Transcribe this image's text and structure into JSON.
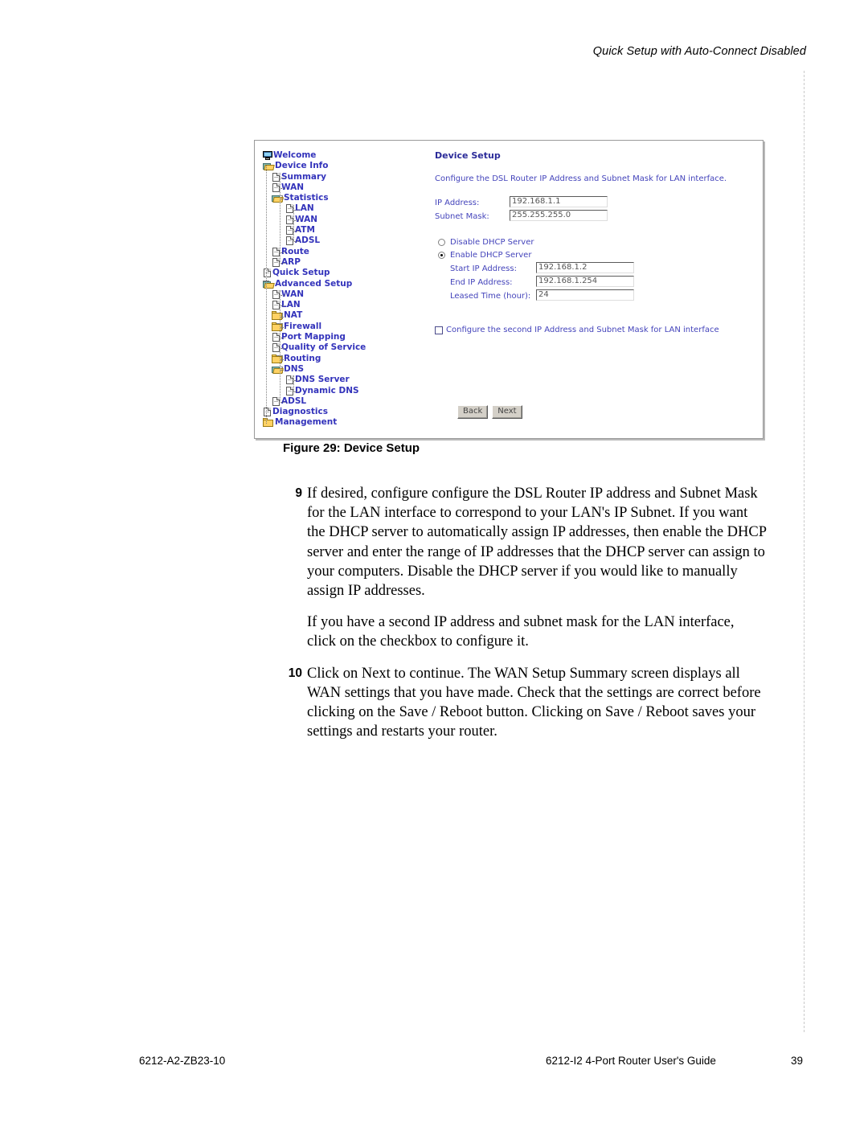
{
  "page": {
    "running_header": "Quick Setup with Auto-Connect Disabled",
    "footer_left": "6212-A2-ZB23-10",
    "footer_guide": "6212-I2 4-Port Router User's Guide",
    "footer_page_number": "39"
  },
  "figure": {
    "caption": "Figure 29: Device Setup"
  },
  "screenshot": {
    "tree": [
      {
        "label": "Welcome",
        "level": 0,
        "icon": "monitor-icon",
        "expander": "none"
      },
      {
        "label": "Device Info",
        "level": 0,
        "icon": "folder-open-icon",
        "expander": "minus"
      },
      {
        "label": "Summary",
        "level": 1,
        "icon": "page-icon",
        "expander": "none"
      },
      {
        "label": "WAN",
        "level": 1,
        "icon": "page-icon",
        "expander": "none"
      },
      {
        "label": "Statistics",
        "level": 1,
        "icon": "folder-open-icon",
        "expander": "minus"
      },
      {
        "label": "LAN",
        "level": 2,
        "icon": "page-icon",
        "expander": "none"
      },
      {
        "label": "WAN",
        "level": 2,
        "icon": "page-icon",
        "expander": "none"
      },
      {
        "label": "ATM",
        "level": 2,
        "icon": "page-icon",
        "expander": "none"
      },
      {
        "label": "ADSL",
        "level": 2,
        "icon": "page-icon",
        "expander": "none"
      },
      {
        "label": "Route",
        "level": 1,
        "icon": "page-icon",
        "expander": "none"
      },
      {
        "label": "ARP",
        "level": 1,
        "icon": "page-icon",
        "expander": "none"
      },
      {
        "label": "Quick Setup",
        "level": 0,
        "icon": "page-icon",
        "expander": "none"
      },
      {
        "label": "Advanced Setup",
        "level": 0,
        "icon": "folder-open-icon",
        "expander": "minus"
      },
      {
        "label": "WAN",
        "level": 1,
        "icon": "page-icon",
        "expander": "none"
      },
      {
        "label": "LAN",
        "level": 1,
        "icon": "page-icon",
        "expander": "none"
      },
      {
        "label": "NAT",
        "level": 1,
        "icon": "folder-icon",
        "expander": "plus"
      },
      {
        "label": "Firewall",
        "level": 1,
        "icon": "folder-icon",
        "expander": "plus"
      },
      {
        "label": "Port Mapping",
        "level": 1,
        "icon": "page-icon",
        "expander": "none"
      },
      {
        "label": "Quality of Service",
        "level": 1,
        "icon": "page-icon",
        "expander": "none"
      },
      {
        "label": "Routing",
        "level": 1,
        "icon": "folder-icon",
        "expander": "plus"
      },
      {
        "label": "DNS",
        "level": 1,
        "icon": "folder-open-icon",
        "expander": "minus"
      },
      {
        "label": "DNS Server",
        "level": 2,
        "icon": "page-icon",
        "expander": "none"
      },
      {
        "label": "Dynamic DNS",
        "level": 2,
        "icon": "page-icon",
        "expander": "none"
      },
      {
        "label": "ADSL",
        "level": 1,
        "icon": "page-icon",
        "expander": "none"
      },
      {
        "label": "Diagnostics",
        "level": 0,
        "icon": "page-icon",
        "expander": "none"
      },
      {
        "label": "Management",
        "level": 0,
        "icon": "folder-icon",
        "expander": "plus"
      }
    ],
    "panel": {
      "title": "Device Setup",
      "description": "Configure the DSL Router IP Address and Subnet Mask for LAN interface.",
      "ip_address_label": "IP Address:",
      "ip_address_value": "192.168.1.1",
      "subnet_mask_label": "Subnet Mask:",
      "subnet_mask_value": "255.255.255.0",
      "disable_dhcp_label": "Disable DHCP Server",
      "enable_dhcp_label": "Enable DHCP Server",
      "dhcp_selected": "Enable DHCP Server",
      "start_ip_label": "Start IP Address:",
      "start_ip_value": "192.168.1.2",
      "end_ip_label": "End IP Address:",
      "end_ip_value": "192.168.1.254",
      "leased_time_label": "Leased Time (hour):",
      "leased_time_value": "24",
      "second_ip_checkbox_label": "Configure the second IP Address and Subnet Mask for LAN interface",
      "second_ip_checked": false,
      "back_button": "Back",
      "next_button": "Next"
    }
  },
  "body": {
    "steps": [
      {
        "number": "9",
        "text": "If desired, configure configure the DSL Router IP address and Subnet Mask for the LAN interface to correspond to your LAN's IP Subnet. If you want the DHCP server to automatically assign IP addresses, then enable the DHCP server and enter the range of IP addresses that the DHCP server can assign to your computers. Disable the DHCP server if you would like to manually assign IP addresses."
      },
      {
        "number": "",
        "text": "If you have a second IP address and subnet mask for the LAN interface, click on the checkbox to configure it."
      },
      {
        "number": "10",
        "text": "Click on Next to continue. The WAN Setup Summary screen displays all WAN settings that you have made. Check that the settings are correct before clicking on the Save / Reboot button. Clicking on Save / Reboot saves your settings and restarts your router."
      }
    ]
  }
}
